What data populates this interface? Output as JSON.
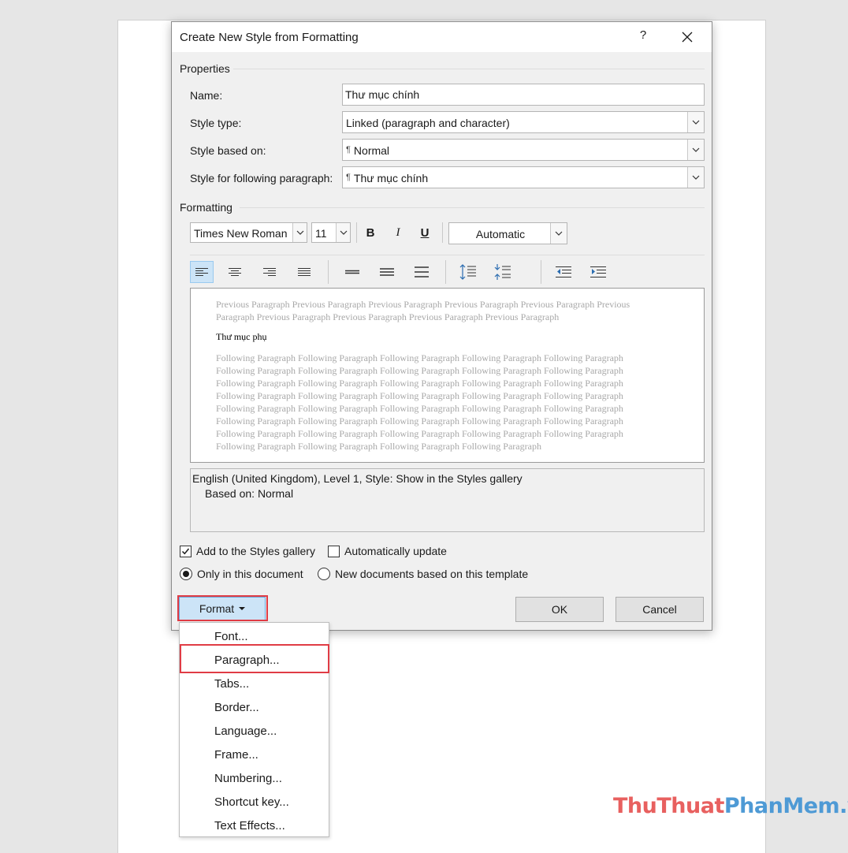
{
  "dialog": {
    "title": "Create New Style from Formatting",
    "help_label": "?"
  },
  "properties": {
    "group_label": "Properties",
    "name_label": "Name:",
    "name_value": "Thư mục chính",
    "style_type_label": "Style type:",
    "style_type_value": "Linked (paragraph and character)",
    "based_on_label": "Style based on:",
    "based_on_value": "Normal",
    "following_label": "Style for following paragraph:",
    "following_value": "Thư mục chính",
    "paragraph_mark": "¶"
  },
  "formatting": {
    "group_label": "Formatting",
    "font_name": "Times New Roman",
    "font_size": "11",
    "bold_label": "B",
    "italic_label": "I",
    "underline_label": "U",
    "color_value": "Automatic",
    "alignment_selected": "align-left"
  },
  "preview": {
    "previous_lines": [
      "Previous Paragraph Previous Paragraph Previous Paragraph Previous Paragraph Previous Paragraph Previous",
      "Paragraph Previous Paragraph Previous Paragraph Previous Paragraph Previous Paragraph"
    ],
    "sample_text": "Thư mục phụ",
    "following_lines": [
      "Following Paragraph Following Paragraph Following Paragraph Following Paragraph Following Paragraph",
      "Following Paragraph Following Paragraph Following Paragraph Following Paragraph Following Paragraph",
      "Following Paragraph Following Paragraph Following Paragraph Following Paragraph Following Paragraph",
      "Following Paragraph Following Paragraph Following Paragraph Following Paragraph Following Paragraph",
      "Following Paragraph Following Paragraph Following Paragraph Following Paragraph Following Paragraph",
      "Following Paragraph Following Paragraph Following Paragraph Following Paragraph Following Paragraph",
      "Following Paragraph Following Paragraph Following Paragraph Following Paragraph Following Paragraph",
      "Following Paragraph Following Paragraph Following Paragraph Following Paragraph"
    ]
  },
  "description": {
    "line1": "English (United Kingdom), Level 1, Style: Show in the Styles gallery",
    "line2": "Based on: Normal"
  },
  "options": {
    "add_to_gallery_label": "Add to the Styles gallery",
    "add_to_gallery_checked": true,
    "auto_update_label": "Automatically update",
    "auto_update_checked": false,
    "only_this_doc_label": "Only in this document",
    "new_docs_label": "New documents based on this template",
    "scope_selected": "only_this_doc"
  },
  "buttons": {
    "format_label": "Format",
    "ok_label": "OK",
    "cancel_label": "Cancel"
  },
  "format_menu": {
    "items": [
      "Font...",
      "Paragraph...",
      "Tabs...",
      "Border...",
      "Language...",
      "Frame...",
      "Numbering...",
      "Shortcut key...",
      "Text Effects..."
    ],
    "highlighted": "Paragraph..."
  },
  "watermark": {
    "part1": "Thu",
    "part2": "Thuat",
    "part3": "Phan",
    "part4": "Mem",
    "part5": ".vn"
  },
  "colors": {
    "highlight_red": "#e03c45",
    "selected_blue": "#cce4f7",
    "watermark_red": "#e8605f",
    "watermark_blue": "#4e9ad5"
  }
}
